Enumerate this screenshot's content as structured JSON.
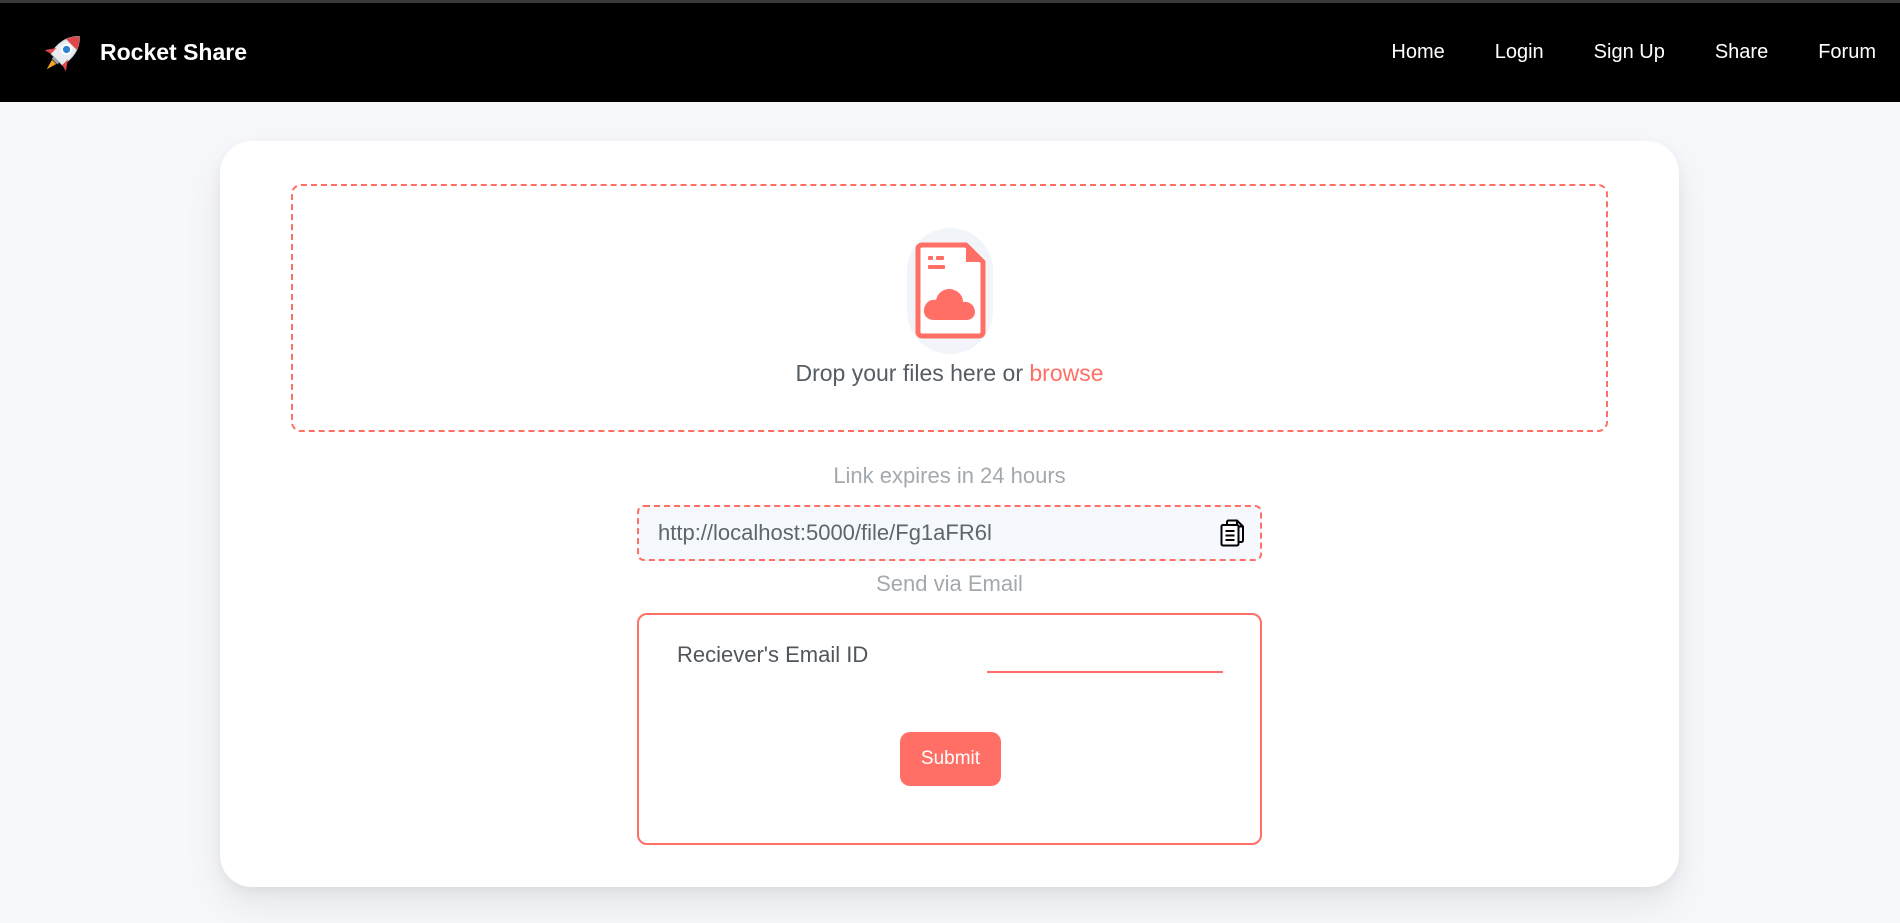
{
  "app": {
    "name": "Rocket Share"
  },
  "nav": {
    "links": [
      "Home",
      "Login",
      "Sign Up",
      "Share",
      "Forum"
    ]
  },
  "upload": {
    "drop_text": "Drop your files here or ",
    "browse_label": "browse",
    "icon": "file-cloud-icon"
  },
  "share": {
    "expires_text": "Link expires in 24 hours",
    "link_value": "http://localhost:5000/file/Fg1aFR6l",
    "copy_icon": "copy-icon",
    "send_via_text": "Send via Email",
    "email_label": "Reciever's Email ID",
    "email_value": "",
    "submit_label": "Submit"
  },
  "colors": {
    "accent": "#ff6f66",
    "navbar": "#000000",
    "background": "#f7f8fb",
    "card": "#ffffff",
    "muted_text": "#a4a9ae"
  }
}
